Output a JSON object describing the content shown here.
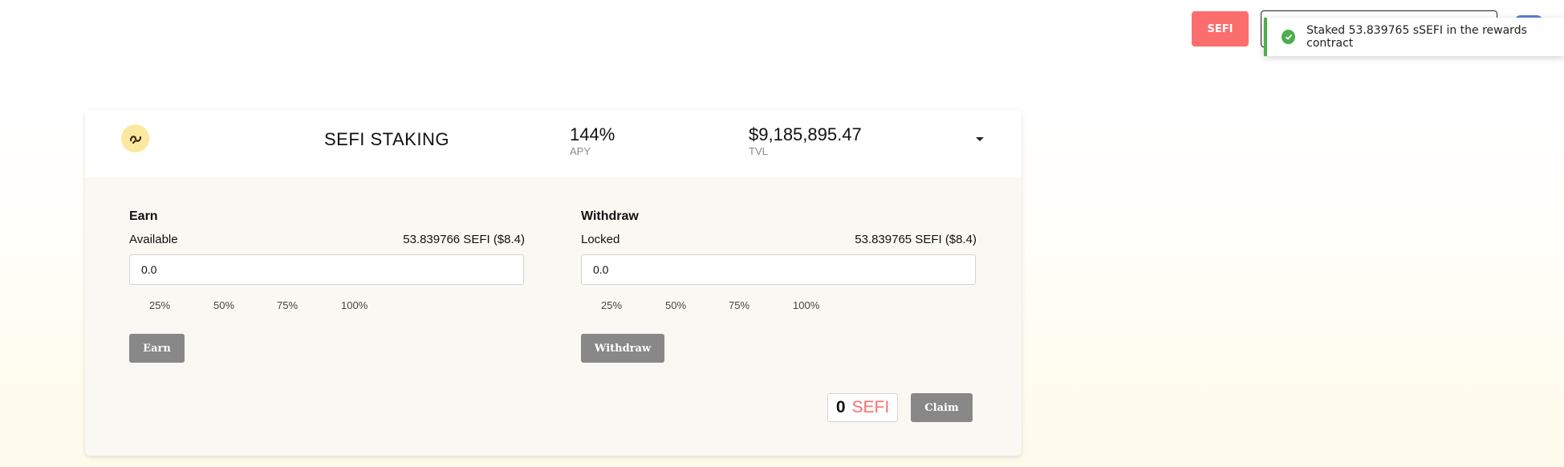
{
  "header": {
    "sefi_button_label": "SEFI"
  },
  "toast": {
    "message": "Staked 53.839765 sSEFI in the rewards contract",
    "status_color": "#4cae4c"
  },
  "card": {
    "title": "SEFI STAKING",
    "apy": {
      "value": "144%",
      "label": "APY"
    },
    "tvl": {
      "value": "$9,185,895.47",
      "label": "TVL"
    },
    "earn": {
      "title": "Earn",
      "balance_label": "Available",
      "balance_value": "53.839766 SEFI ($8.4)",
      "input_value": "0.0",
      "percent_options": [
        "25%",
        "50%",
        "75%",
        "100%"
      ],
      "button_label": "Earn"
    },
    "withdraw": {
      "title": "Withdraw",
      "balance_label": "Locked",
      "balance_value": "53.839765 SEFI ($8.4)",
      "input_value": "0.0",
      "percent_options": [
        "25%",
        "50%",
        "75%",
        "100%"
      ],
      "button_label": "Withdraw"
    },
    "rewards": {
      "amount": "0",
      "unit": "SEFI",
      "claim_label": "Claim"
    }
  },
  "colors": {
    "accent": "#fc6e6e",
    "button_gray": "#888888"
  }
}
